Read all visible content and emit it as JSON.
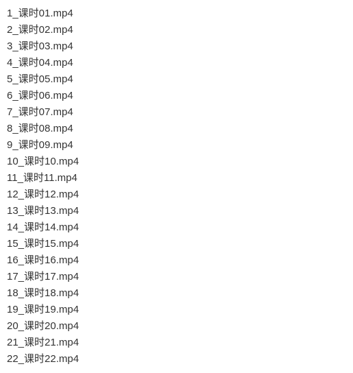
{
  "files": [
    {
      "name": "1_课时01.mp4"
    },
    {
      "name": "2_课时02.mp4"
    },
    {
      "name": "3_课时03.mp4"
    },
    {
      "name": "4_课时04.mp4"
    },
    {
      "name": "5_课时05.mp4"
    },
    {
      "name": "6_课时06.mp4"
    },
    {
      "name": "7_课时07.mp4"
    },
    {
      "name": "8_课时08.mp4"
    },
    {
      "name": "9_课时09.mp4"
    },
    {
      "name": "10_课时10.mp4"
    },
    {
      "name": "11_课时11.mp4"
    },
    {
      "name": "12_课时12.mp4"
    },
    {
      "name": "13_课时13.mp4"
    },
    {
      "name": "14_课时14.mp4"
    },
    {
      "name": "15_课时15.mp4"
    },
    {
      "name": "16_课时16.mp4"
    },
    {
      "name": "17_课时17.mp4"
    },
    {
      "name": "18_课时18.mp4"
    },
    {
      "name": "19_课时19.mp4"
    },
    {
      "name": "20_课时20.mp4"
    },
    {
      "name": "21_课时21.mp4"
    },
    {
      "name": "22_课时22.mp4"
    }
  ]
}
